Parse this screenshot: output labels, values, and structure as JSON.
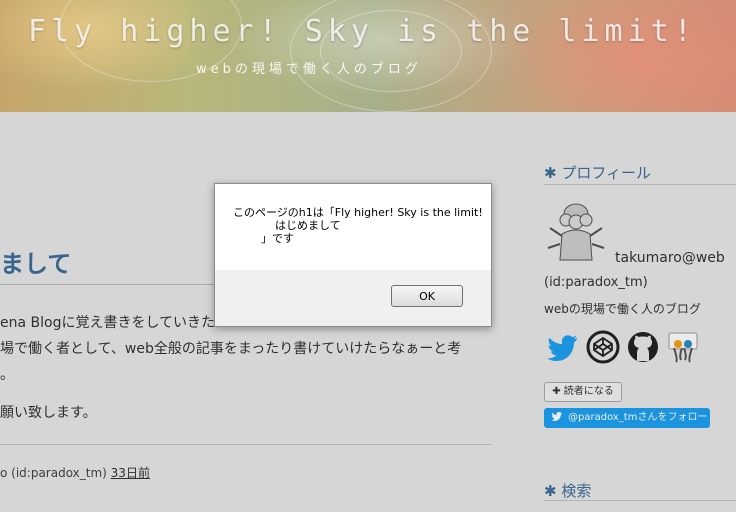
{
  "header": {
    "title": "Fly higher! Sky is the limit!",
    "description": "webの現場で働く人のブログ"
  },
  "entry": {
    "title": "まして",
    "paragraphs": [
      "ena Blogに覚え書きをしていきた",
      "場で働く者として、web全般の記事をまったり書けていけたらなぁーと考",
      "。",
      "願い致します。"
    ],
    "footer_author": "o (id:paradox_tm) ",
    "footer_date": "33日前"
  },
  "sidebar": {
    "profile_heading": "プロフィール",
    "username": "takumaro@web",
    "user_id": "(id:paradox_tm)",
    "user_desc": "webの現場で働く人のブログ",
    "sns_icons": [
      "twitter-icon",
      "codepen-icon",
      "github-icon",
      "slideshare-icon"
    ],
    "reader_button": "読者になる",
    "follow_button": "@paradox_tmさんをフォロー",
    "search_heading": "検索"
  },
  "dialog": {
    "message": "このページのh1は「Fly higher! Sky is the limit!\n            はじめまして\n        」です",
    "ok_label": "OK"
  },
  "colors": {
    "accent": "#3d6e9a",
    "twitter": "#1da1f2"
  }
}
